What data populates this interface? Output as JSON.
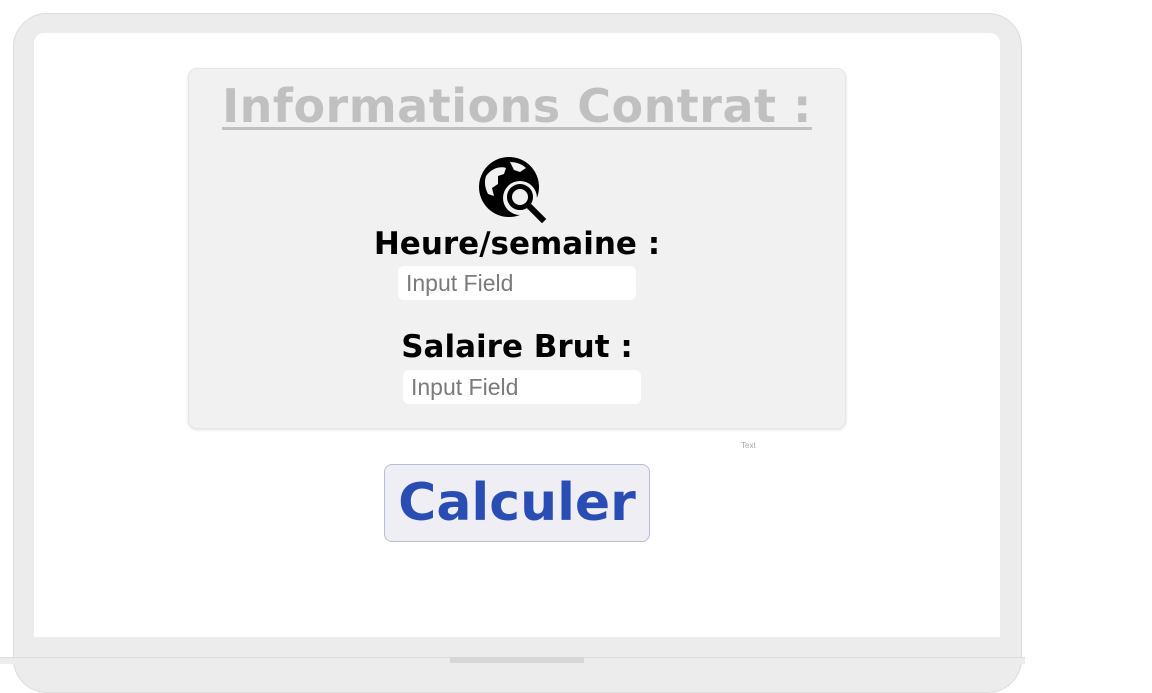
{
  "card": {
    "title": "Informations Contrat :",
    "icon": "travel-explore-icon"
  },
  "fields": {
    "hours_label": "Heure/semaine :",
    "hours_placeholder": "Input Field",
    "hours_value": "",
    "salary_label": "Salaire Brut :",
    "salary_placeholder": "Input Field",
    "salary_value": ""
  },
  "misc": {
    "tiny_text": "Text"
  },
  "actions": {
    "calculate_label": "Calculer"
  },
  "colors": {
    "title": "#c0c0c0",
    "button_text": "#2a4db4",
    "card_bg": "#f1f1f1"
  }
}
